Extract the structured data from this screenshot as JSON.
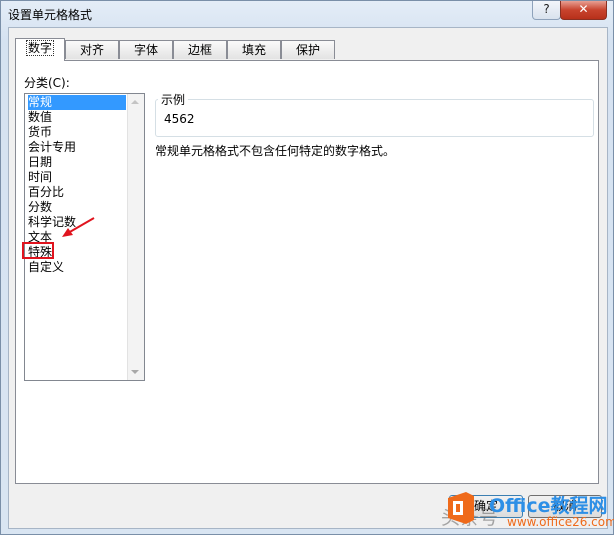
{
  "window": {
    "title": "设置单元格格式",
    "help_label": "?",
    "close_label": "✕"
  },
  "tabs": [
    {
      "label": "数字",
      "active": true
    },
    {
      "label": "对齐"
    },
    {
      "label": "字体"
    },
    {
      "label": "边框"
    },
    {
      "label": "填充"
    },
    {
      "label": "保护"
    }
  ],
  "category": {
    "label": "分类(C):",
    "items": [
      "常规",
      "数值",
      "货币",
      "会计专用",
      "日期",
      "时间",
      "百分比",
      "分数",
      "科学记数",
      "文本",
      "特殊",
      "自定义"
    ],
    "selected_index": 0,
    "annotated_item": "特殊"
  },
  "sample": {
    "legend": "示例",
    "value": "4562"
  },
  "description": "常规单元格格式不包含任何特定的数字格式。",
  "buttons": {
    "ok": "确定",
    "cancel": "取消"
  },
  "watermark": {
    "brand": "Office教程网",
    "url": "www.office26.com",
    "overlay_text": "头条号"
  },
  "colors": {
    "selection": "#3399ff",
    "annotation": "#e0141e",
    "close_button": "#c8432d",
    "brand": "#2d8fe6",
    "logo": "#ef6a1a"
  }
}
